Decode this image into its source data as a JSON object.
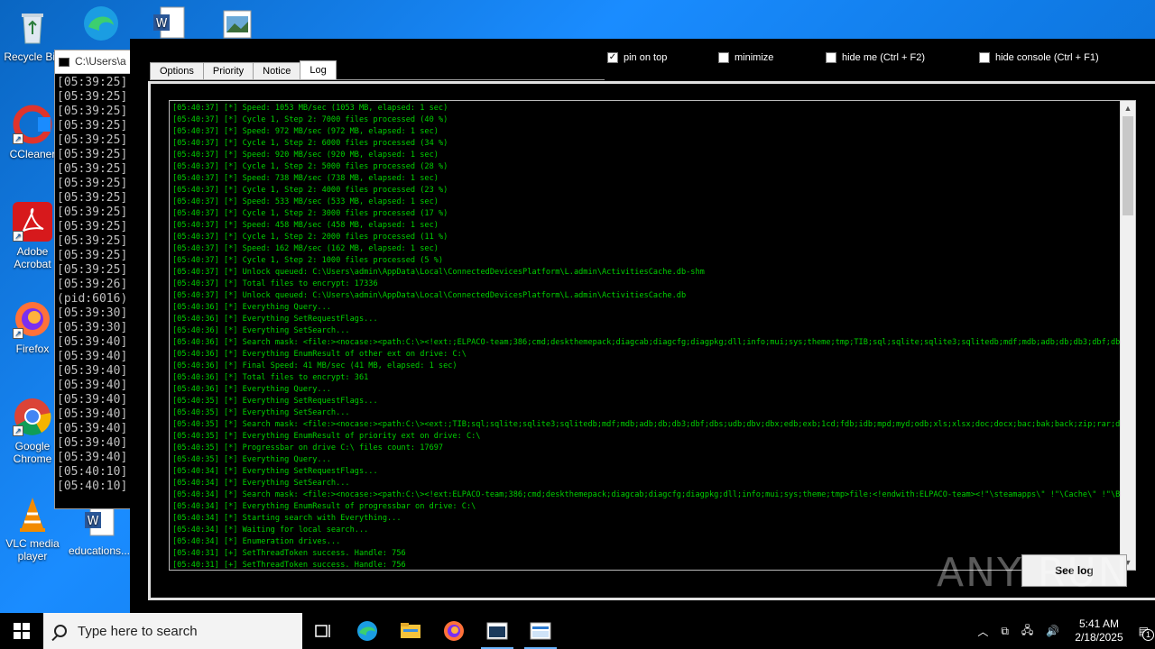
{
  "desktop": {
    "icons": [
      {
        "label": "Recycle Bin",
        "icon": "recycle-bin-icon"
      },
      {
        "label": "CCleaner",
        "icon": "ccleaner-icon"
      },
      {
        "label": "Adobe Acrobat",
        "icon": "adobe-acrobat-icon"
      },
      {
        "label": "Firefox",
        "icon": "firefox-icon"
      },
      {
        "label": "Google Chrome",
        "icon": "chrome-icon"
      },
      {
        "label": "VLC media player",
        "icon": "vlc-icon"
      },
      {
        "label": "educations...",
        "icon": "word-doc-icon"
      }
    ]
  },
  "console": {
    "title": "C:\\Users\\a",
    "lines": [
      "[05:39:25]",
      "[05:39:25]",
      "[05:39:25]",
      "[05:39:25]",
      "[05:39:25]",
      "[05:39:25]",
      "[05:39:25]",
      "[05:39:25]",
      "[05:39:25]",
      "[05:39:25]",
      "[05:39:25]",
      "[05:39:25]",
      "[05:39:25]",
      "[05:39:25]",
      "[05:39:26]",
      " (pid:6016)",
      "[05:39:30]",
      "[05:39:30]",
      "[05:39:40]",
      "[05:39:40]",
      "[05:39:40]",
      "[05:39:40]",
      "[05:39:40]",
      "[05:39:40]",
      "[05:39:40]",
      "[05:39:40]",
      "[05:39:40]",
      "[05:40:10]",
      "[05:40:10]"
    ]
  },
  "app": {
    "tabs": [
      "Options",
      "Priority",
      "Notice",
      "Log"
    ],
    "active_tab": "Log",
    "checks": {
      "pin_on_top": "pin on top",
      "minimize": "minimize",
      "hide_me": "hide me (Ctrl + F2)",
      "hide_console": "hide console (Ctrl + F1)"
    },
    "log_lines": [
      "[05:40:37] [*] Speed: 1053 MB/sec (1053 MB, elapsed: 1 sec)",
      "[05:40:37] [*] Cycle 1, Step 2: 7000 files processed (40 %)",
      "[05:40:37] [*] Speed: 972 MB/sec (972 MB, elapsed: 1 sec)",
      "[05:40:37] [*] Cycle 1, Step 2: 6000 files processed (34 %)",
      "[05:40:37] [*] Speed: 920 MB/sec (920 MB, elapsed: 1 sec)",
      "[05:40:37] [*] Cycle 1, Step 2: 5000 files processed (28 %)",
      "[05:40:37] [*] Speed: 738 MB/sec (738 MB, elapsed: 1 sec)",
      "[05:40:37] [*] Cycle 1, Step 2: 4000 files processed (23 %)",
      "[05:40:37] [*] Speed: 533 MB/sec (533 MB, elapsed: 1 sec)",
      "[05:40:37] [*] Cycle 1, Step 2: 3000 files processed (17 %)",
      "[05:40:37] [*] Speed: 458 MB/sec (458 MB, elapsed: 1 sec)",
      "[05:40:37] [*] Cycle 1, Step 2: 2000 files processed (11 %)",
      "[05:40:37] [*] Speed: 162 MB/sec (162 MB, elapsed: 1 sec)",
      "[05:40:37] [*] Cycle 1, Step 2: 1000 files processed (5 %)",
      "[05:40:37] [*] Unlock queued: C:\\Users\\admin\\AppData\\Local\\ConnectedDevicesPlatform\\L.admin\\ActivitiesCache.db-shm",
      "[05:40:37] [*] Total files to encrypt: 17336",
      "[05:40:37] [*] Unlock queued: C:\\Users\\admin\\AppData\\Local\\ConnectedDevicesPlatform\\L.admin\\ActivitiesCache.db",
      "[05:40:36] [*] Everything Query...",
      "[05:40:36] [*] Everything SetRequestFlags...",
      "[05:40:36] [*] Everything SetSearch...",
      "[05:40:36] [*] Search mask: <file:><nocase:><path:C:\\><!ext:;ELPACO-team;386;cmd;deskthemepack;diagcab;diagcfg;diagpkg;dll;info;mui;sys;theme;tmp;TIB;sql;sqlite;sqlite3;sqlitedb;mdf;mdb;adb;db;db3;dbf;dbs;udb;dbv;dbx;ed",
      "[05:40:36] [*] Everything EnumResult of other ext on drive: C:\\",
      "[05:40:36] [*] Final Speed: 41 MB/sec (41 MB, elapsed: 1 sec)",
      "[05:40:36] [*] Total files to encrypt: 361",
      "[05:40:36] [*] Everything Query...",
      "[05:40:35] [*] Everything SetRequestFlags...",
      "[05:40:35] [*] Everything SetSearch...",
      "[05:40:35] [*] Search mask: <file:><nocase:><path:C:\\><ext:;TIB;sql;sqlite;sqlite3;sqlitedb;mdf;mdb;adb;db;db3;dbf;dbs;udb;dbv;dbx;edb;exb;1cd;fdb;idb;mpd;myd;odb;xls;xlsx;doc;docx;bac;bak;back;zip;rar;dt;4dd;4dl;abcddb;abs;",
      "[05:40:35] [*] Everything EnumResult of priority ext on drive: C:\\",
      "[05:40:35] [*] Progressbar on drive C:\\ files count: 17697",
      "[05:40:35] [*] Everything Query...",
      "[05:40:34] [*] Everything SetRequestFlags...",
      "[05:40:34] [*] Everything SetSearch...",
      "[05:40:34] [*] Search mask: <file:><nocase:><path:C:\\><!ext:ELPACO-team;386;cmd;deskthemepack;diagcab;diagcfg;diagpkg;dll;info;mui;sys;theme;tmp>file:<!endwith:ELPACO-team><!\"\\steamapps\\\" !\"\\Cache\\\" !\"\\Boot\\\" !\"\\Chrom",
      "[05:40:34] [*] Everything EnumResult of progressbar on drive: C:\\",
      "[05:40:34] [*] Starting search with Everything...",
      "[05:40:34] [*] Waiting for local search...",
      "[05:40:34] [*] Enumeration drives...",
      "[05:40:31] [+] SetThreadToken success. Handle: 756",
      "[05:40:31] [+] SetThreadToken success. Handle: 756"
    ],
    "see_log_button": "See log"
  },
  "watermark": "ANY RUN",
  "taskbar": {
    "search_placeholder": "Type here to search",
    "date": "2/18/2025",
    "time": "5:41 AM",
    "notification_count": "1"
  }
}
